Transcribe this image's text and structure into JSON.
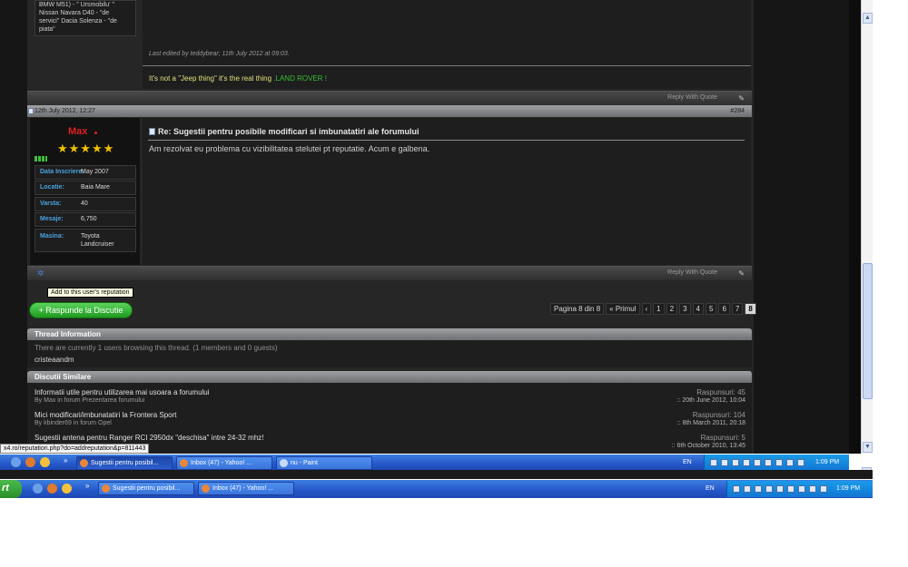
{
  "post1": {
    "sig_lines": [
      "BMW M51) - \" Ursmobilu' \"",
      "Nissan Navara D40 - \"de",
      "servici\" Dacia Solenza - \"de",
      "piata\""
    ],
    "edited": "Last edited by teddybear; 11th July 2012 at 09:03.",
    "signature_text": "It's not a \"Jeep thing\" it's the real thing",
    "signature_brand": ".LAND ROVER !",
    "reply_with_quote": "Reply With Quote"
  },
  "post2": {
    "date": "12th July 2012, 12:27",
    "number": "#284",
    "username": "Max",
    "stars": "★★★★★",
    "info": [
      {
        "key": "Data Inscriere:",
        "value": "May 2007"
      },
      {
        "key": "Locatie:",
        "value": "Baia Mare"
      },
      {
        "key": "Varsta:",
        "value": "40"
      },
      {
        "key": "Mesaje:",
        "value": "6,750"
      },
      {
        "key": "Masina:",
        "value": "Toyota Landcruiser"
      }
    ],
    "title": "Re: Sugestii pentru posibile modificari si imbunatatiri ale forumului",
    "body": "Am rezolvat eu problema cu vizibilitatea stelutei pt reputatie. Acum e galbena.",
    "reply_with_quote": "Reply With Quote"
  },
  "tooltip": "Add to this user's reputation",
  "reply_button": "+ Raspunde la Discutie",
  "pagination": {
    "page_label": "Pagina 8 din 8",
    "first": "« Primul",
    "prev": "‹",
    "pages": [
      "1",
      "2",
      "3",
      "4",
      "5",
      "6",
      "7",
      "8"
    ]
  },
  "thread_info": {
    "header": "Thread Information",
    "browsing": "There are currently 1 users browsing this thread. (1 members and 0 guests)",
    "member": "cristeaandm"
  },
  "similar": {
    "header": "Discutii Similare",
    "items": [
      {
        "title": "Informatii utile pentru utilizarea mai usoara a forumului",
        "by": "By Max in forum Prezentarea forumului",
        "replies": "Raspunsuri: 45",
        "date": ":: 20th June 2012, 10:04"
      },
      {
        "title": "Mici modificari/imbunatatiri la Frontera Sport",
        "by": "By kbinder69 in forum Opel",
        "replies": "Raspunsuri: 104",
        "date": ":: 8th March 2011, 20:18"
      },
      {
        "title": "Sugestii antena pentru Ranger RCI 2950dx \"deschisa\" intre 24-32 mhz!",
        "by": "",
        "replies": "Raspunsuri: 5",
        "date": ":: 6th October 2010, 13:45"
      }
    ]
  },
  "status_url": "x4.ro/reputation.php?do=addreputation&p=811443",
  "taskbar_inner": {
    "buttons": [
      "Sugestii pentru posibil...",
      "Inbox (47) - Yahoo! ...",
      "nu - Paint"
    ],
    "lang": "EN",
    "clock": "1:09 PM"
  },
  "taskbar_outer": {
    "start": "rt",
    "buttons": [
      "Sugestii pentru posibil...",
      "Inbox (47) - Yahoo! ..."
    ],
    "lang": "EN",
    "clock": "1:09 PM"
  },
  "colors": {
    "accent_green": "#35c035",
    "username_red": "#e02020",
    "star_gold": "#f0c000",
    "info_key_blue": "#4aa3df"
  }
}
